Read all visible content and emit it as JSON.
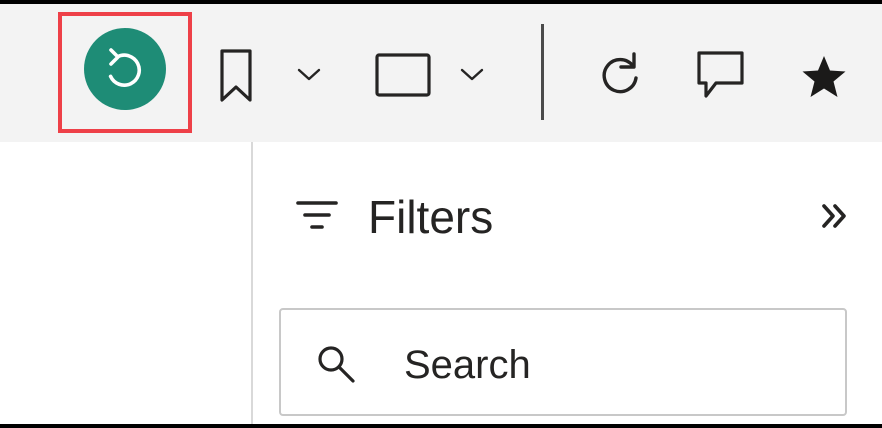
{
  "toolbar": {
    "icons": [
      "reset-icon",
      "bookmark-icon",
      "chevron-down-icon",
      "view-icon",
      "chevron-down-icon",
      "refresh-icon",
      "comment-icon",
      "star-icon"
    ],
    "accent_color": "#1e8c76",
    "highlight_color": "#ee4048"
  },
  "filters": {
    "title": "Filters",
    "collapse_icon": "double-chevron-right-icon",
    "filter_icon": "filter-icon"
  },
  "search": {
    "placeholder": "Search",
    "value": "",
    "icon": "search-icon"
  }
}
